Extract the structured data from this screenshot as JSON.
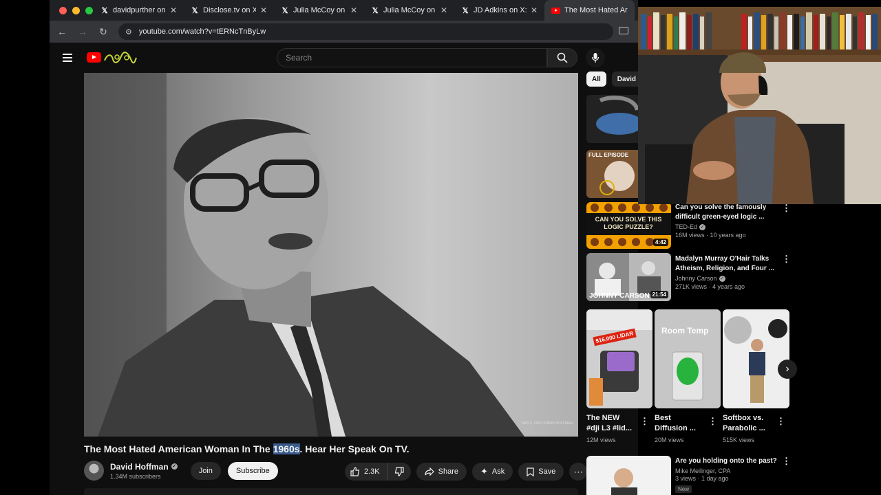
{
  "browser": {
    "tabs": [
      {
        "favicon": "x-icon",
        "title": "davidpurther on X",
        "active": false
      },
      {
        "favicon": "x-icon",
        "title": "Disclose.tv on X: \"U",
        "active": false
      },
      {
        "favicon": "x-icon",
        "title": "Julia McCoy on X: \"",
        "active": false
      },
      {
        "favicon": "x-icon",
        "title": "Julia McCoy on X: \"",
        "active": false
      },
      {
        "favicon": "x-icon",
        "title": "JD Adkins on X: \"@",
        "active": false
      },
      {
        "favicon": "youtube-icon",
        "title": "The Most Hated Ar",
        "active": true
      }
    ],
    "url": "youtube.com/watch?v=tERNcTnByLw"
  },
  "youtube": {
    "search_placeholder": "Search",
    "video": {
      "title_before": "The Most Hated American Woman In The ",
      "title_highlight": "1960s",
      "title_after": ". Hear Her Speak On TV.",
      "watermark": "MAY 6, 1965 / DAVID HOFFMAN"
    },
    "channel": {
      "name": "David Hoffman",
      "subscribers": "1.34M subscribers",
      "join_label": "Join",
      "subscribe_label": "Subscribe"
    },
    "actions": {
      "likes": "2.3K",
      "share_label": "Share",
      "ask_label": "Ask",
      "save_label": "Save"
    },
    "chips": [
      {
        "label": "All",
        "selected": true
      },
      {
        "label": "David H",
        "selected": false
      }
    ],
    "sidebar": [
      {
        "title_line1": "",
        "title_line2": "",
        "channel": "",
        "meta": "",
        "duration": "",
        "badge": ""
      },
      {
        "title_line1": "",
        "title_line2": "",
        "channel": "",
        "meta": "",
        "duration": "",
        "badge": "FULL EPISODE"
      },
      {
        "title_line1": "Can you solve the famously",
        "title_line2": "difficult green-eyed logic ...",
        "channel": "TED-Ed",
        "meta": "16M views · 10 years ago",
        "duration": "4:42",
        "thumb_text": "CAN YOU SOLVE THIS LOGIC PUZZLE?"
      },
      {
        "title_line1": "Madalyn Murray O'Hair Talks",
        "title_line2": "Atheism, Religion, and Four ...",
        "channel": "Johnny Carson",
        "meta": "271K views · 4 years ago",
        "duration": "21:54",
        "thumb_text": "JOHNNY CARSON"
      }
    ],
    "shorts": [
      {
        "title_line1": "The NEW",
        "title_line2": "#dji L3 #lid...",
        "views": "12M views",
        "thumb_text": "$16,000 LIDAR"
      },
      {
        "title_line1": "Best",
        "title_line2": "Diffusion ...",
        "views": "20M views",
        "thumb_text": "Room Temp"
      },
      {
        "title_line1": "Softbox vs.",
        "title_line2": "Parabolic ...",
        "views": "515K views",
        "thumb_text": ""
      }
    ],
    "bottom_item": {
      "title": "Are you holding onto the past?",
      "channel": "Mike Meilinger, CPA",
      "meta": "3 views · 1 day ago",
      "badge": "New"
    }
  }
}
